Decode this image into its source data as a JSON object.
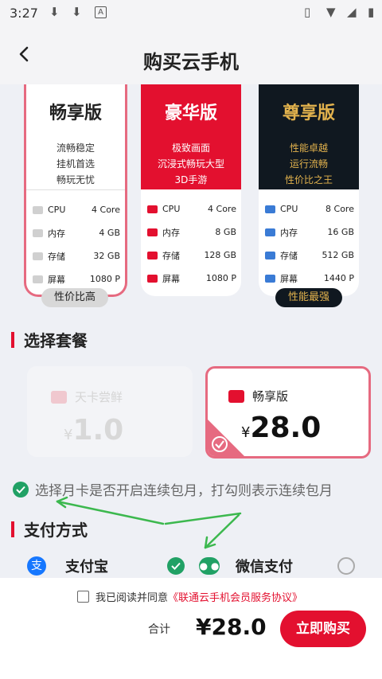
{
  "status_bar": {
    "time": "3:27",
    "icons": [
      "download-icon",
      "download-icon",
      "a-icon",
      "vibrate-icon",
      "wifi-icon",
      "signal-icon",
      "battery-icon"
    ]
  },
  "header": {
    "title": "购买云手机"
  },
  "cards": [
    {
      "name": "畅享版",
      "lines": [
        "流畅稳定",
        "挂机首选",
        "畅玩无忧"
      ],
      "badge": "性价比高",
      "specs": [
        {
          "label": "CPU",
          "value": "4 Core"
        },
        {
          "label": "内存",
          "value": "4 GB"
        },
        {
          "label": "存储",
          "value": "32 GB"
        },
        {
          "label": "屏幕",
          "value": "1080 P"
        }
      ]
    },
    {
      "name": "豪华版",
      "lines": [
        "极致画面",
        "沉浸式畅玩大型",
        "3D手游"
      ],
      "specs": [
        {
          "label": "CPU",
          "value": "4 Core"
        },
        {
          "label": "内存",
          "value": "8 GB"
        },
        {
          "label": "存储",
          "value": "128 GB"
        },
        {
          "label": "屏幕",
          "value": "1080 P"
        }
      ]
    },
    {
      "name": "尊享版",
      "lines": [
        "性能卓越",
        "运行流畅",
        "性价比之王"
      ],
      "badge": "性能最强",
      "specs": [
        {
          "label": "CPU",
          "value": "8 Core"
        },
        {
          "label": "内存",
          "value": "16 GB"
        },
        {
          "label": "存储",
          "value": "512 GB"
        },
        {
          "label": "屏幕",
          "value": "1440 P"
        }
      ]
    }
  ],
  "plan_section": {
    "title": "选择套餐"
  },
  "plans": [
    {
      "name": "天卡尝鲜",
      "currency": "¥",
      "price": "1.0",
      "selected": false
    },
    {
      "name": "畅享版",
      "currency": "¥",
      "price": "28.0",
      "selected": true
    }
  ],
  "notice": "选择月卡是否开启连续包月，打勾则表示连续包月",
  "payment_section": {
    "title": "支付方式"
  },
  "payments": [
    {
      "name": "支付宝",
      "selected": true
    },
    {
      "name": "微信支付",
      "selected": false
    }
  ],
  "footer": {
    "agree_prefix": "我已阅读并同意",
    "agree_link": "《联通云手机会员服务协议》",
    "total_label": "合计",
    "total": "¥28.0",
    "buy_button": "立即购买"
  },
  "colors": {
    "accent": "#e3102f",
    "pink": "#e66a80",
    "dark": "#101820",
    "gold": "#e2b24d",
    "green": "#21a165"
  }
}
